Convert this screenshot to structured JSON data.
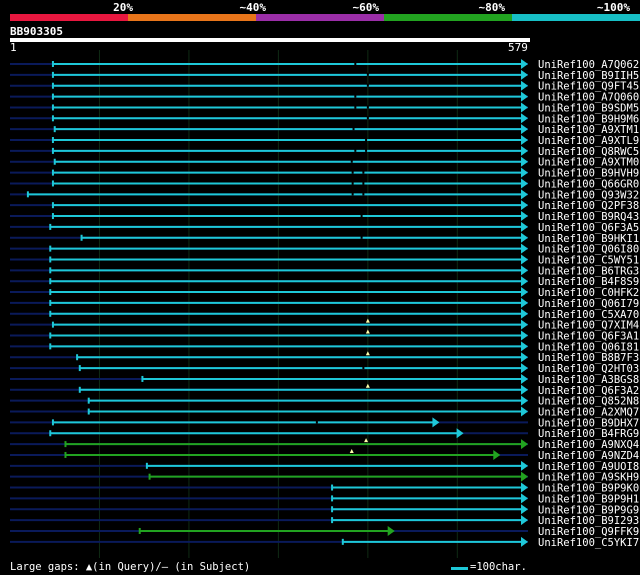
{
  "legend": {
    "labels": [
      "20%",
      "~40%",
      "~60%",
      "~80%",
      "~100%"
    ],
    "colors": [
      "#e8173f",
      "#e8751a",
      "#9b2ea8",
      "#22a320",
      "#17bfc6"
    ]
  },
  "query": {
    "name": "BB903305",
    "start": "1",
    "end": "579",
    "length": 579
  },
  "hits": [
    {
      "id": "UniRef100_A7Q062",
      "start": 48,
      "end": 579,
      "color": "#1ec8d8",
      "markers": [
        {
          "pos": 386,
          "type": "dot"
        }
      ]
    },
    {
      "id": "UniRef100_B9IIH5",
      "start": 48,
      "end": 579,
      "color": "#1ec8d8",
      "markers": [
        {
          "pos": 400,
          "type": "dot"
        }
      ]
    },
    {
      "id": "UniRef100_Q9FT45",
      "start": 48,
      "end": 579,
      "color": "#1ec8d8",
      "markers": [
        {
          "pos": 400,
          "type": "dot"
        }
      ]
    },
    {
      "id": "UniRef100_A7Q060",
      "start": 48,
      "end": 579,
      "color": "#1ec8d8",
      "markers": [
        {
          "pos": 386,
          "type": "dot"
        }
      ]
    },
    {
      "id": "UniRef100_B9SDM5",
      "start": 48,
      "end": 579,
      "color": "#1ec8d8",
      "markers": [
        {
          "pos": 386,
          "type": "dot"
        },
        {
          "pos": 400,
          "type": "dot"
        }
      ]
    },
    {
      "id": "UniRef100_B9H9M6",
      "start": 48,
      "end": 579,
      "color": "#1ec8d8",
      "markers": [
        {
          "pos": 400,
          "type": "dot"
        }
      ]
    },
    {
      "id": "UniRef100_A9XTM1",
      "start": 50,
      "end": 579,
      "color": "#1ec8d8",
      "markers": [
        {
          "pos": 384,
          "type": "dot"
        }
      ]
    },
    {
      "id": "UniRef100_A9XTL9",
      "start": 48,
      "end": 579,
      "color": "#1ec8d8",
      "markers": [
        {
          "pos": 398,
          "type": "dot"
        }
      ]
    },
    {
      "id": "UniRef100_Q8RWC5",
      "start": 48,
      "end": 579,
      "color": "#1ec8d8",
      "markers": [
        {
          "pos": 386,
          "type": "dot"
        },
        {
          "pos": 398,
          "type": "dot"
        }
      ]
    },
    {
      "id": "UniRef100_A9XTM0",
      "start": 50,
      "end": 579,
      "color": "#1ec8d8",
      "markers": [
        {
          "pos": 382,
          "type": "dot"
        }
      ]
    },
    {
      "id": "UniRef100_B9HVH9",
      "start": 48,
      "end": 579,
      "color": "#1ec8d8",
      "markers": [
        {
          "pos": 383,
          "type": "dot"
        },
        {
          "pos": 395,
          "type": "dot"
        }
      ]
    },
    {
      "id": "UniRef100_Q66GR0",
      "start": 48,
      "end": 579,
      "color": "#1ec8d8",
      "markers": [
        {
          "pos": 383,
          "type": "dot"
        },
        {
          "pos": 395,
          "type": "dot"
        }
      ]
    },
    {
      "id": "UniRef100_Q93W32",
      "start": 20,
      "end": 579,
      "color": "#1ec8d8",
      "markers": [
        {
          "pos": 383,
          "type": "dot"
        },
        {
          "pos": 395,
          "type": "dot"
        }
      ]
    },
    {
      "id": "UniRef100_Q2PF38",
      "start": 48,
      "end": 579,
      "color": "#1ec8d8",
      "markers": []
    },
    {
      "id": "UniRef100_B9RQ43",
      "start": 48,
      "end": 579,
      "color": "#1ec8d8",
      "markers": [
        {
          "pos": 393,
          "type": "dot"
        }
      ]
    },
    {
      "id": "UniRef100_Q6F3A5",
      "start": 45,
      "end": 579,
      "color": "#1ec8d8",
      "markers": []
    },
    {
      "id": "UniRef100_B9HKI1",
      "start": 80,
      "end": 579,
      "color": "#1ec8d8",
      "markers": [
        {
          "pos": 393,
          "type": "dot"
        }
      ]
    },
    {
      "id": "UniRef100_Q06I80",
      "start": 45,
      "end": 579,
      "color": "#1ec8d8",
      "markers": []
    },
    {
      "id": "UniRef100_C5WY51",
      "start": 45,
      "end": 579,
      "color": "#1ec8d8",
      "markers": []
    },
    {
      "id": "UniRef100_B6TRG3",
      "start": 45,
      "end": 579,
      "color": "#1ec8d8",
      "markers": []
    },
    {
      "id": "UniRef100_B4F8S9",
      "start": 45,
      "end": 579,
      "color": "#1ec8d8",
      "markers": []
    },
    {
      "id": "UniRef100_C0HFK2",
      "start": 45,
      "end": 579,
      "color": "#1ec8d8",
      "markers": []
    },
    {
      "id": "UniRef100_Q06I79",
      "start": 45,
      "end": 579,
      "color": "#1ec8d8",
      "markers": []
    },
    {
      "id": "UniRef100_C5XA70",
      "start": 45,
      "end": 579,
      "color": "#1ec8d8",
      "markers": []
    },
    {
      "id": "UniRef100_Q7XIM4",
      "start": 48,
      "end": 579,
      "color": "#1ec8d8",
      "markers": [
        {
          "pos": 400,
          "type": "triangle"
        }
      ]
    },
    {
      "id": "UniRef100_Q6F3A1",
      "start": 45,
      "end": 579,
      "color": "#1ec8d8",
      "markers": [
        {
          "pos": 400,
          "type": "triangle"
        }
      ]
    },
    {
      "id": "UniRef100_Q06I81",
      "start": 45,
      "end": 579,
      "color": "#1ec8d8",
      "markers": []
    },
    {
      "id": "UniRef100_B8B7F3",
      "start": 75,
      "end": 579,
      "color": "#1ec8d8",
      "markers": [
        {
          "pos": 400,
          "type": "triangle"
        }
      ]
    },
    {
      "id": "UniRef100_Q2HT03",
      "start": 78,
      "end": 579,
      "color": "#1ec8d8",
      "markers": [
        {
          "pos": 395,
          "type": "dot"
        }
      ]
    },
    {
      "id": "UniRef100_A3BGS8",
      "start": 148,
      "end": 579,
      "color": "#1ec8d8",
      "markers": []
    },
    {
      "id": "UniRef100_Q6F3A2",
      "start": 78,
      "end": 579,
      "color": "#1ec8d8",
      "markers": [
        {
          "pos": 400,
          "type": "triangle"
        }
      ]
    },
    {
      "id": "UniRef100_Q852N8",
      "start": 88,
      "end": 579,
      "color": "#1ec8d8",
      "markers": []
    },
    {
      "id": "UniRef100_A2XMQ7",
      "start": 88,
      "end": 579,
      "color": "#1ec8d8",
      "markers": []
    },
    {
      "id": "UniRef100_B9DHX7",
      "start": 48,
      "end": 480,
      "color": "#1ec8d8",
      "markers": [
        {
          "pos": 343,
          "type": "dot"
        }
      ]
    },
    {
      "id": "UniRef100_B4FRG9",
      "start": 45,
      "end": 507,
      "color": "#1ec8d8",
      "markers": []
    },
    {
      "id": "UniRef100_A9NXQ4",
      "start": 62,
      "end": 579,
      "color": "#22a320",
      "markers": [
        {
          "pos": 398,
          "type": "triangle"
        }
      ]
    },
    {
      "id": "UniRef100_A9NZD4",
      "start": 62,
      "end": 548,
      "color": "#22a320",
      "markers": [
        {
          "pos": 382,
          "type": "triangle"
        }
      ]
    },
    {
      "id": "UniRef100_A9UOI8",
      "start": 153,
      "end": 579,
      "color": "#1ec8d8",
      "markers": []
    },
    {
      "id": "UniRef100_A9SKH9",
      "start": 156,
      "end": 579,
      "color": "#22a320",
      "markers": []
    },
    {
      "id": "UniRef100_B9P9K0",
      "start": 360,
      "end": 579,
      "color": "#1ec8d8",
      "markers": []
    },
    {
      "id": "UniRef100_B9P9H1",
      "start": 360,
      "end": 579,
      "color": "#1ec8d8",
      "markers": []
    },
    {
      "id": "UniRef100_B9P9G9",
      "start": 360,
      "end": 579,
      "color": "#1ec8d8",
      "markers": []
    },
    {
      "id": "UniRef100_B9I293",
      "start": 360,
      "end": 579,
      "color": "#1ec8d8",
      "markers": []
    },
    {
      "id": "UniRef100_Q9FFK9",
      "start": 145,
      "end": 430,
      "color": "#22a320",
      "markers": []
    },
    {
      "id": "UniRef100_C5YKI7",
      "start": 372,
      "end": 579,
      "color": "#1ec8d8",
      "markers": []
    }
  ],
  "footer": {
    "gaps_text": "Large gaps: ▲(in Query)/– (in Subject)",
    "scale_text": "=100char."
  }
}
